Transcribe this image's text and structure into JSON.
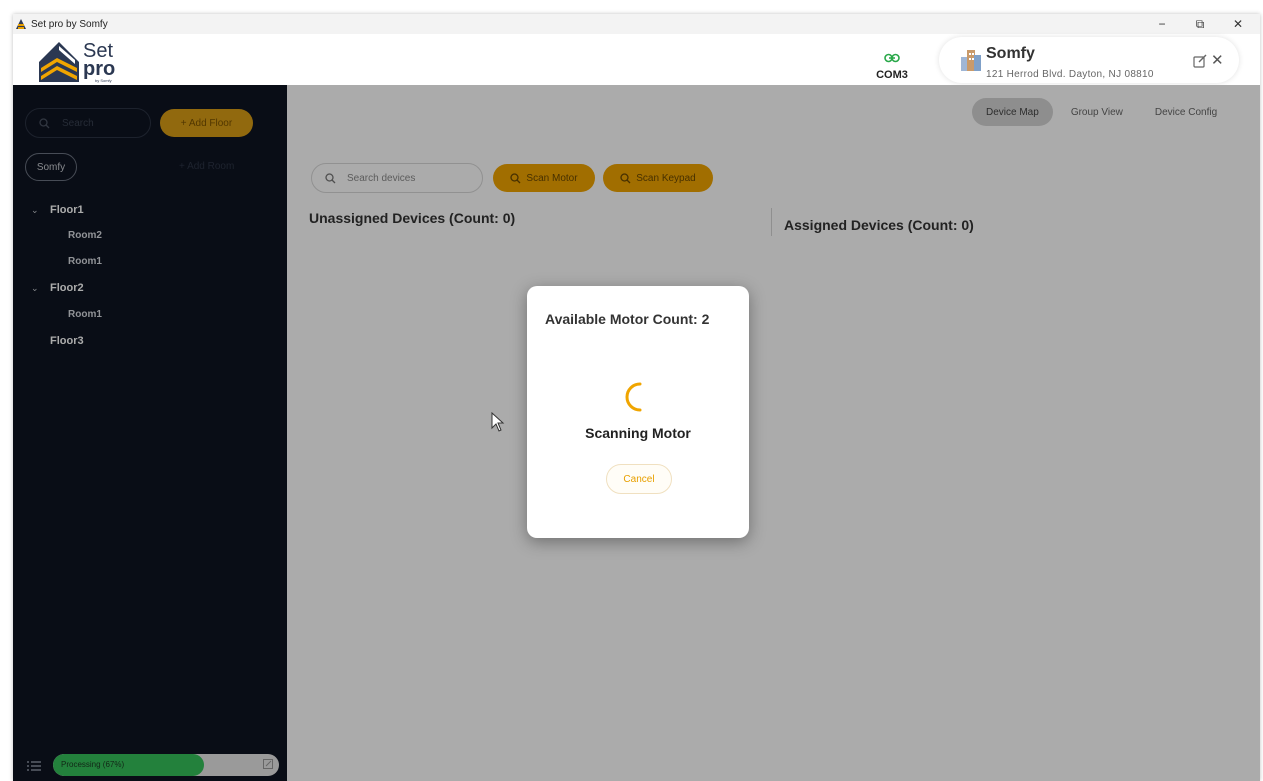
{
  "window": {
    "title": "Set pro by Somfy",
    "controls": {
      "minimize": "−",
      "restore": "⧉",
      "close": "✕"
    }
  },
  "header": {
    "logo": {
      "line1": "Set",
      "line2": "pro",
      "line3": "by Somfy"
    },
    "connection": {
      "icon": "link-icon",
      "label": "COM3",
      "color": "#2aa84a"
    },
    "site": {
      "name": "Somfy",
      "address": "121 Herrod Blvd. Dayton, NJ 08810",
      "edit_icon": "edit-icon",
      "close_icon": "close-icon"
    }
  },
  "sidebar": {
    "search_placeholder": "Search",
    "add_floor_label": "+ Add Floor",
    "site_chip": "Somfy",
    "add_room_label": "+ Add Room",
    "tree": [
      {
        "label": "Floor1",
        "expanded": true,
        "rooms": [
          "Room2",
          "Room1"
        ]
      },
      {
        "label": "Floor2",
        "expanded": true,
        "rooms": [
          "Room1"
        ]
      },
      {
        "label": "Floor3",
        "expanded": false,
        "rooms": []
      }
    ],
    "progress": {
      "label": "Processing (67%)",
      "value": 0.67,
      "color": "#35c05a"
    }
  },
  "main": {
    "tabs": [
      {
        "label": "Device Map",
        "active": true
      },
      {
        "label": "Group View",
        "active": false
      },
      {
        "label": "Device Config",
        "active": false
      }
    ],
    "device_search_placeholder": "Search devices",
    "scan_motor_label": "Scan Motor",
    "scan_keypad_label": "Scan Keypad",
    "unassigned_title": "Unassigned Devices (Count: 0)",
    "assigned_title": "Assigned Devices (Count: 0)",
    "accent_color": "#f0a500"
  },
  "modal": {
    "count_text": "Available Motor Count: 2",
    "status_text": "Scanning Motor",
    "cancel_label": "Cancel",
    "spinner_color": "#f0a500"
  }
}
